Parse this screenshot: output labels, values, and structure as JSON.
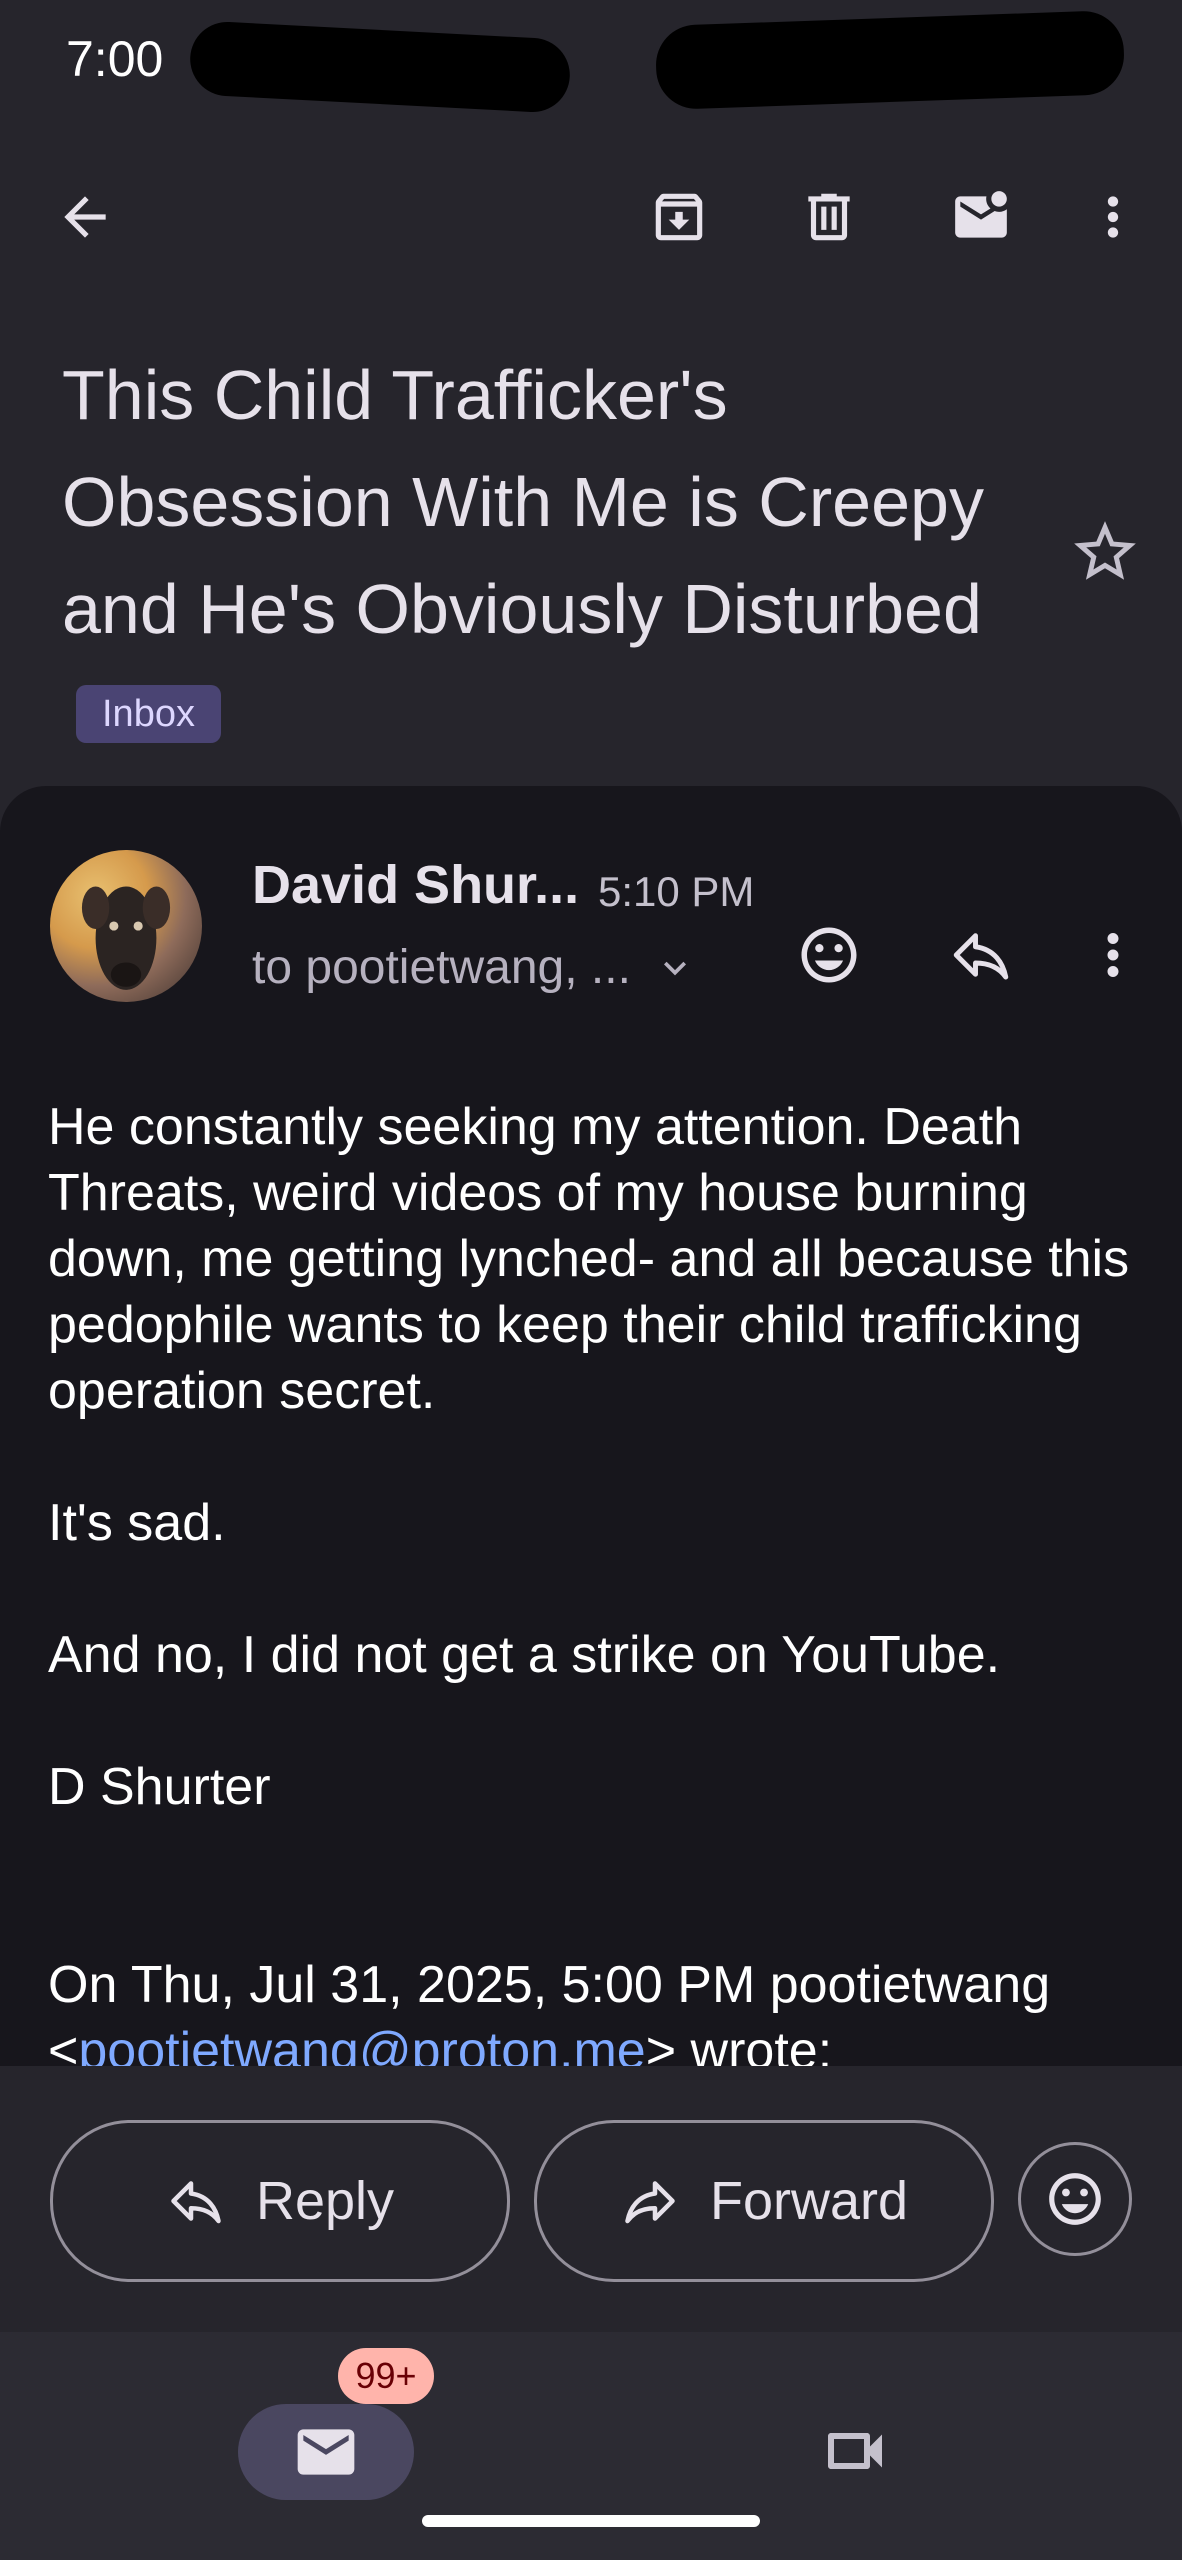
{
  "status_bar": {
    "time": "7:00"
  },
  "toolbar": {
    "back_icon": "arrow-left-icon",
    "archive_icon": "archive-icon",
    "delete_icon": "trash-icon",
    "mark_unread_icon": "mail-unread-icon",
    "more_icon": "more-vertical-icon"
  },
  "email": {
    "subject": "This Child Trafficker's Obsession With Me is Creepy and He's Obviously Disturbed",
    "label": "Inbox",
    "sender": "David Shur...",
    "time": "5:10 PM",
    "recipients": "to pootietwang, ...",
    "body": {
      "paragraph1": "He constantly seeking my attention. Death Threats, weird videos of my house burning down, me getting lynched- and all because this pedophile wants to keep their child trafficking operation secret.",
      "paragraph2": "It's sad.",
      "paragraph3": "And no, I did not get a strike on YouTube.",
      "signature": "D Shurter",
      "quote_header": "On Thu, Jul 31, 2025, 5:00 PM pootietwang",
      "quote_open": "<",
      "quote_email": "pootietwang@proton.me",
      "quote_close": "> wrote:"
    }
  },
  "actions": {
    "reply_label": "Reply",
    "forward_label": "Forward"
  },
  "bottom_nav": {
    "mail_badge": "99+"
  },
  "colors": {
    "background": "#26252c",
    "card": "#17161c",
    "inbox_badge": "#4a4473",
    "link": "#7fa9ff",
    "notification_badge": "#ffb4ab"
  }
}
